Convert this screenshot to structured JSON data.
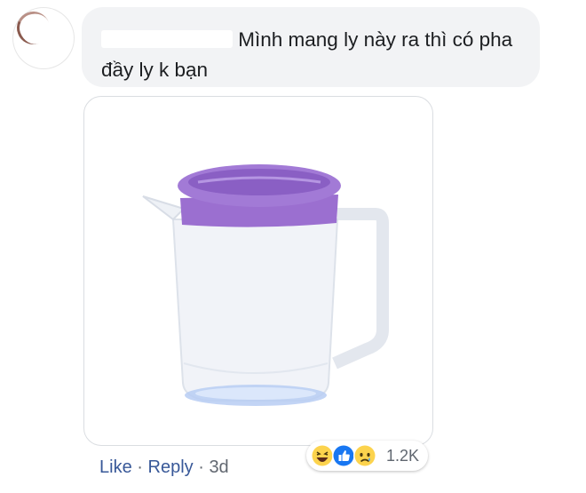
{
  "comment": {
    "text": "Mình mang ly này ra thì có pha đầy ly k bạn"
  },
  "attachment": {
    "icon": "plastic-pitcher-icon",
    "colors": {
      "lid": "#9b6fd0",
      "lid_dark": "#7e52b8",
      "body": "#eef1f6",
      "base": "#a8c4f0"
    }
  },
  "actions": {
    "like_label": "Like",
    "reply_label": "Reply",
    "separator": "·",
    "time": "3d"
  },
  "reactions": {
    "icons": [
      "haha-icon",
      "like-icon",
      "sad-icon"
    ],
    "count": "1.2K"
  }
}
